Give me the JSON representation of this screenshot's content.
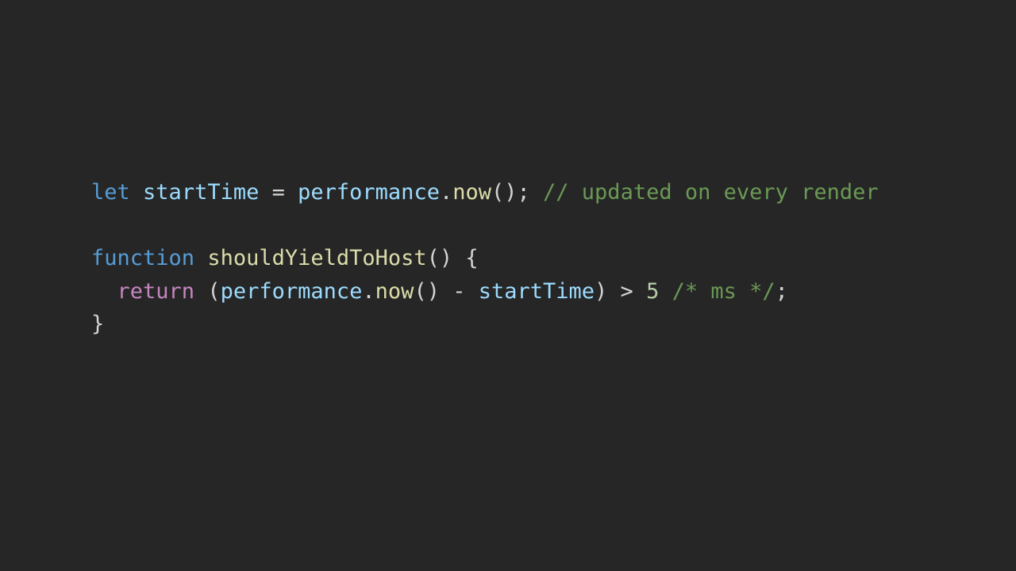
{
  "code": {
    "language": "javascript",
    "colors": {
      "background": "#262626",
      "keyword": "#569cd6",
      "control": "#c586c0",
      "variable": "#9cdcfe",
      "function": "#dcdcaa",
      "punctuation": "#d4d4d4",
      "number": "#b5cea8",
      "comment": "#6a9955"
    },
    "lines": [
      {
        "tokens": [
          {
            "type": "keyword",
            "text": "let"
          },
          {
            "type": "punct",
            "text": " "
          },
          {
            "type": "variable",
            "text": "startTime"
          },
          {
            "type": "punct",
            "text": " = "
          },
          {
            "type": "variable",
            "text": "performance"
          },
          {
            "type": "punct",
            "text": "."
          },
          {
            "type": "function",
            "text": "now"
          },
          {
            "type": "punct",
            "text": "(); "
          },
          {
            "type": "comment",
            "text": "// updated on every render"
          }
        ]
      },
      {
        "tokens": []
      },
      {
        "tokens": [
          {
            "type": "keyword",
            "text": "function"
          },
          {
            "type": "punct",
            "text": " "
          },
          {
            "type": "function",
            "text": "shouldYieldToHost"
          },
          {
            "type": "punct",
            "text": "() {"
          }
        ]
      },
      {
        "tokens": [
          {
            "type": "punct",
            "text": "  "
          },
          {
            "type": "control",
            "text": "return"
          },
          {
            "type": "punct",
            "text": " ("
          },
          {
            "type": "variable",
            "text": "performance"
          },
          {
            "type": "punct",
            "text": "."
          },
          {
            "type": "function",
            "text": "now"
          },
          {
            "type": "punct",
            "text": "() - "
          },
          {
            "type": "variable",
            "text": "startTime"
          },
          {
            "type": "punct",
            "text": ") > "
          },
          {
            "type": "number",
            "text": "5"
          },
          {
            "type": "punct",
            "text": " "
          },
          {
            "type": "comment",
            "text": "/* ms */"
          },
          {
            "type": "punct",
            "text": ";"
          }
        ]
      },
      {
        "tokens": [
          {
            "type": "punct",
            "text": "}"
          }
        ]
      }
    ]
  }
}
